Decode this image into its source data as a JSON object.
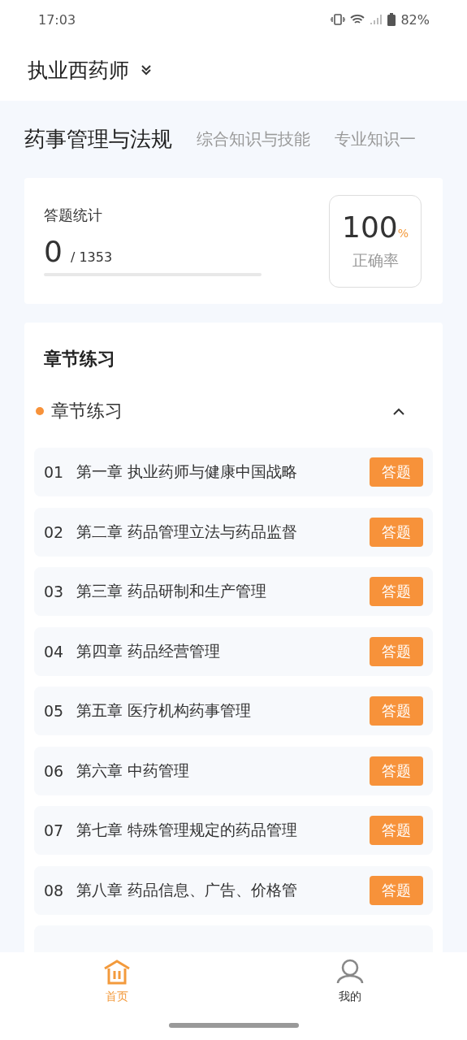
{
  "status_bar": {
    "time": "17:03",
    "battery": "82%"
  },
  "header": {
    "title": "执业西药师"
  },
  "tabs": [
    {
      "label": "药事管理与法规",
      "selected": true
    },
    {
      "label": "综合知识与技能",
      "selected": false
    },
    {
      "label": "专业知识一",
      "selected": false
    }
  ],
  "stats": {
    "title": "答题统计",
    "answered": "0",
    "total": "/ 1353",
    "level": 0,
    "accuracy": "100",
    "accuracy_unit": "%",
    "accuracy_label": "正确率"
  },
  "practice": {
    "title": "章节练习",
    "section": {
      "title": "章节练习",
      "expanded": true
    },
    "chapters": [
      {
        "number": "01",
        "title": "第一章 执业药师与健康中国战略",
        "button": "答题"
      },
      {
        "number": "02",
        "title": "第二章 药品管理立法与药品监督",
        "button": "答题"
      },
      {
        "number": "03",
        "title": "第三章 药品研制和生产管理",
        "button": "答题"
      },
      {
        "number": "04",
        "title": "第四章 药品经营管理",
        "button": "答题"
      },
      {
        "number": "05",
        "title": "第五章 医疗机构药事管理",
        "button": "答题"
      },
      {
        "number": "06",
        "title": "第六章 中药管理",
        "button": "答题"
      },
      {
        "number": "07",
        "title": "第七章 特殊管理规定的药品管理",
        "button": "答题"
      },
      {
        "number": "08",
        "title": "第八章 药品信息、广告、价格管",
        "button": "答题"
      }
    ]
  },
  "bottom_nav": [
    {
      "label": "首页",
      "kind": "home",
      "selected": true
    },
    {
      "label": "我的",
      "kind": "profile",
      "selected": false
    }
  ]
}
